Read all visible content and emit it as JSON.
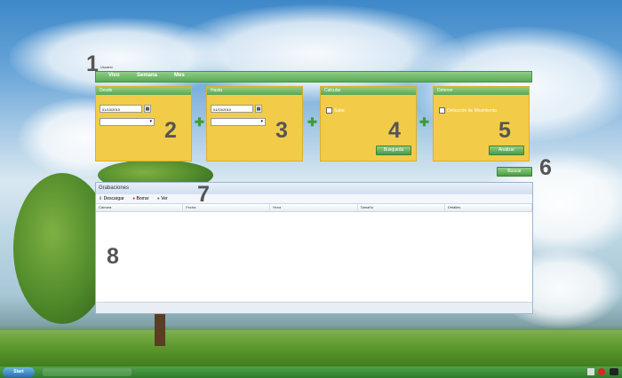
{
  "menubar": {
    "title": "Usuario",
    "items": [
      "Vivo",
      "Semana",
      "Mes"
    ]
  },
  "panels": {
    "desde": {
      "label": "Desde",
      "date": "01/10/2010",
      "time_placeholder": ""
    },
    "hasta": {
      "label": "Hasta",
      "date": "01/10/2010",
      "time_placeholder": ""
    },
    "calcular": {
      "label": "Calcular",
      "checkbox_label": "Sabe",
      "button_label": "Busqueda"
    },
    "detener": {
      "label": "Detener",
      "checkbox_label": "Detección de Movimiento",
      "button_label": "Analizar"
    }
  },
  "buscar_button": "Buscar",
  "grid": {
    "title": "Grabaciones",
    "toolbar": [
      "Descargar",
      "Borrar",
      "Ver"
    ],
    "columns": [
      "Cámara",
      "Fecha",
      "Hora",
      "Tamaño",
      "Detalles"
    ]
  },
  "markers": [
    "1",
    "2",
    "3",
    "4",
    "5",
    "6",
    "7",
    "8"
  ],
  "taskbar": {
    "start_label": "Start"
  },
  "colors": {
    "accent_green": "#5aa854",
    "panel_yellow": "#f2cc48"
  }
}
